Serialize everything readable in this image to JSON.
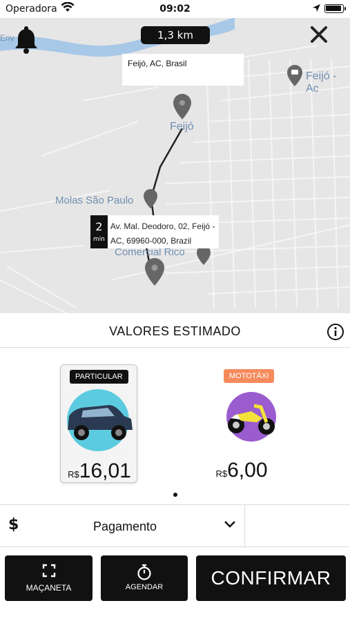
{
  "status_bar": {
    "carrier": "Operadora",
    "time": "09:02"
  },
  "map": {
    "distance": "1,3 km",
    "origin_address": "Feijó, AC, Brasil",
    "labels": {
      "feijo": "Feijó",
      "feijo_poi": "Feijó - Ac",
      "molas": "Molas São Paulo",
      "comercial": "Comercial Rico",
      "env": "Env"
    },
    "marker": {
      "eta_value": "2",
      "eta_unit": "min",
      "address": "Av. Mal. Deodoro, 02, Feijó - AC, 69960-000, Brazil"
    }
  },
  "estimate": {
    "title": "VALORES ESTIMADO"
  },
  "options": [
    {
      "tag": "PARTICULAR",
      "currency": "R$",
      "price": "16,01",
      "selected": true,
      "tag_color": "#111111"
    },
    {
      "tag": "MOTOTÁXI",
      "currency": "R$",
      "price": "6,00",
      "selected": false,
      "tag_color": "#f58b5c"
    }
  ],
  "payment": {
    "icon": "$",
    "label": "Pagamento"
  },
  "actions": {
    "macaneta": "MAÇANETA",
    "agendar": "AGENDAR",
    "confirmar": "CONFIRMAR"
  },
  "colors": {
    "map_bg": "#e6e6e6",
    "river": "#a8c8e8",
    "label": "#6f8fb0",
    "moto_circle": "#9a5ccf",
    "car_circle": "#5ccbe0"
  }
}
